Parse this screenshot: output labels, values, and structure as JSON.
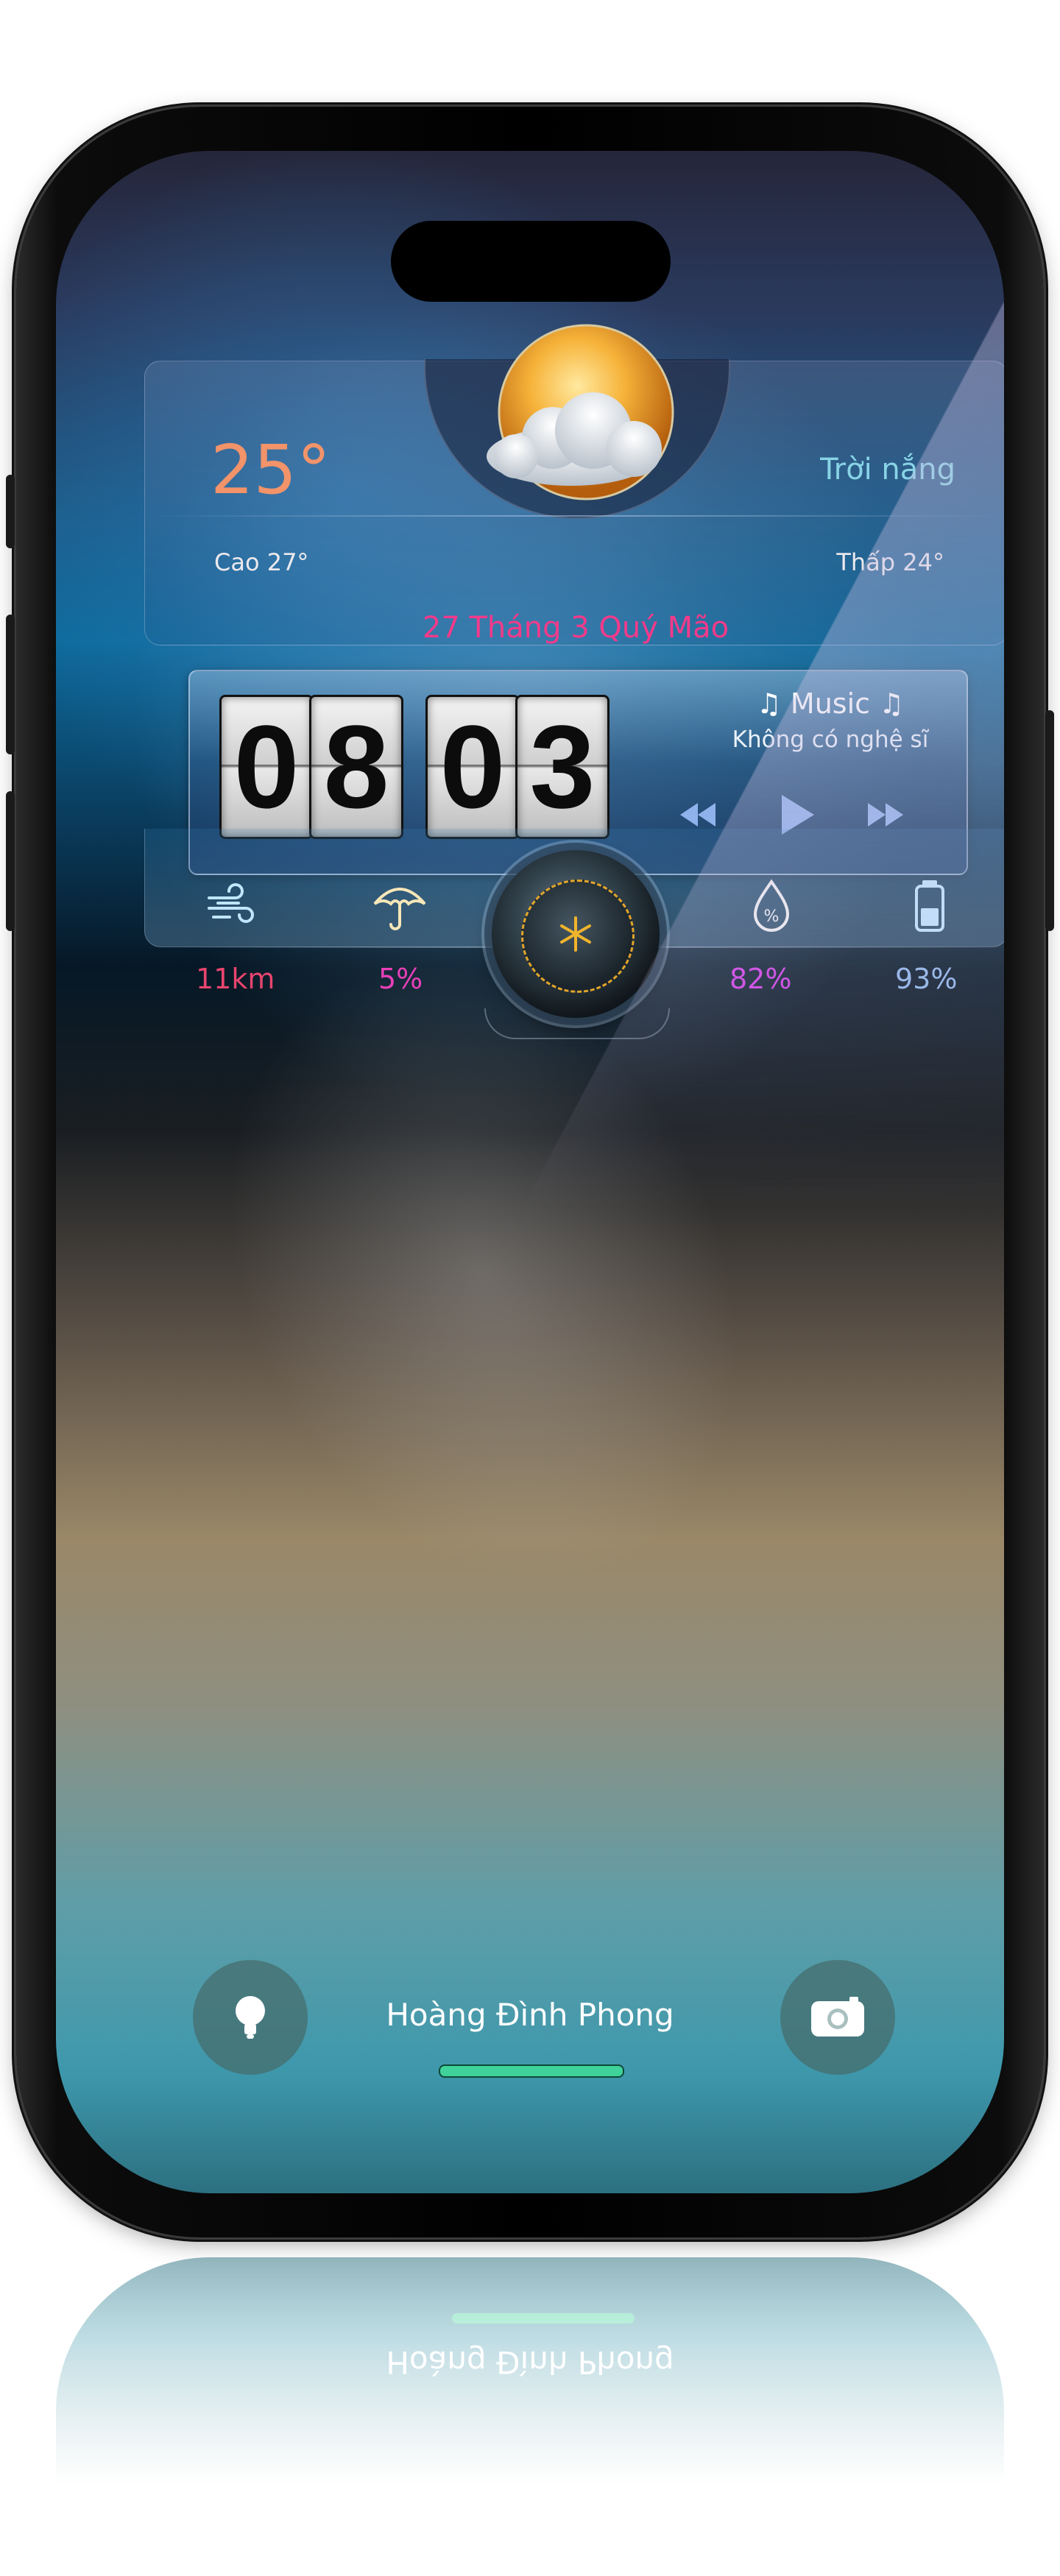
{
  "weather": {
    "temperature": "25°",
    "condition": "Trời nắng",
    "high": "Cao 27°",
    "low": "Thấp 24°",
    "lunar_date": "27 Tháng 3 Quý Mão",
    "icon": "sun-cloud-icon"
  },
  "clock": {
    "hour_digits": [
      "0",
      "8"
    ],
    "minute_digits": [
      "0",
      "3"
    ]
  },
  "music": {
    "title": "♫ Music ♫",
    "artist": "Không có nghệ sĩ",
    "controls": [
      "rewind-icon",
      "play-icon",
      "fast-forward-icon"
    ]
  },
  "stats": [
    {
      "icon": "wind-icon",
      "value": "11km",
      "color": "#e8456e"
    },
    {
      "icon": "umbrella-icon",
      "value": "5%",
      "color": "#e83fb8"
    },
    {
      "icon": "humidity-drop-icon",
      "value": "82%",
      "color": "#d23fe8"
    },
    {
      "icon": "battery-icon",
      "value": "93%",
      "color": "#8fb7ea"
    }
  ],
  "center_knob": {
    "icon": "snowflake-icon"
  },
  "lockscreen": {
    "owner_name": "Hoàng Đình Phong",
    "left_button_icon": "flashlight-icon",
    "right_button_icon": "camera-icon"
  },
  "colors": {
    "temperature": "#f2936a",
    "condition": "#88d4e6",
    "lunar_date": "#f23a8a",
    "home_indicator": "#3fd29a"
  }
}
